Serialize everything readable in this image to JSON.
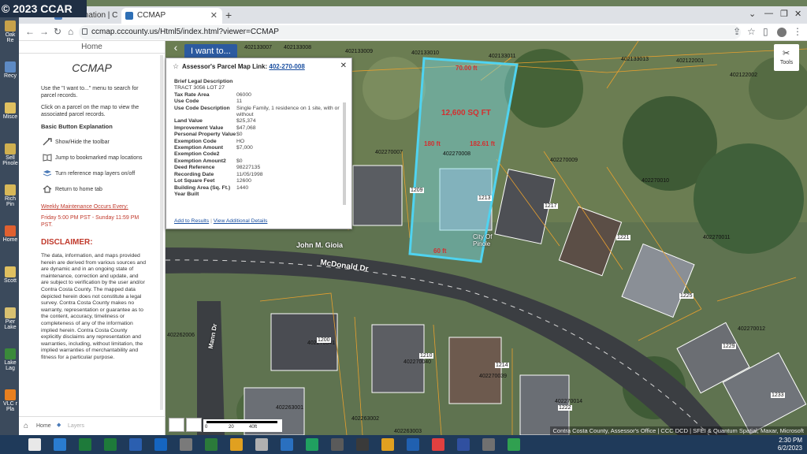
{
  "desktop": {
    "copyright": "© 2023 CCAR",
    "icons": [
      "Oak Re",
      "Recy",
      "Misce",
      "Sell Pinole",
      "Rich Pin",
      "Home",
      "Scott",
      "Pier Lake",
      "Lake Lag",
      "VLC r Pla"
    ]
  },
  "browser": {
    "tabs": [
      {
        "label": "Information | C"
      },
      {
        "label": "CCMAP"
      }
    ],
    "url": "ccmap.cccounty.us/Html5/index.html?viewer=CCMAP"
  },
  "sidebar": {
    "home": "Home",
    "title": "CCMAP",
    "intro1": "Use the \"I want to...\" menu to search for parcel records.",
    "intro2": "Click on a parcel on the map to view the associated parcel records.",
    "basic_heading": "Basic Button Explanation",
    "buttons": [
      {
        "label": "Show/Hide the toolbar",
        "icon": "tools-icon"
      },
      {
        "label": "Jump to bookmarked map locations",
        "icon": "bookmark-icon"
      },
      {
        "label": "Turn reference map layers on/off",
        "icon": "layers-icon"
      },
      {
        "label": "Return to home tab",
        "icon": "home-icon"
      }
    ],
    "maintenance": "Weekly Maintenance Occurs Every:",
    "maintenance_time": "Friday 5:00 PM PST - Sunday 11:59 PM PST.",
    "disclaimer_heading": "DISCLAIMER:",
    "disclaimer": "The data, information, and maps provided herein are derived from various sources and are dynamic and in an ongoing state of maintenance, correction and update, and are subject to verification by the user and/or Contra Costa County. The mapped data depicted herein does not constitute a legal survey. Contra Costa County makes no warranty, representation or guarantee as to the content, accuracy, timeliness or completeness of any of the information implied herein. Contra Costa County explicitly disclaims any representation and warranties, including, without limitation, the implied warranties of merchantability and fitness for a particular purpose.",
    "bottom_home": "Home",
    "bottom_layers": "Layers"
  },
  "map": {
    "i_want_to": "I want to...",
    "tools": "Tools",
    "attribution": "Contra Costa County, Assessor's Office | CCC DCD | SFEI & Quantum Spatial, Maxar, Microsoft",
    "scale": {
      "zero": "0",
      "mid": "20",
      "end": "40ft"
    },
    "parcel_labels": [
      "402133007",
      "402133008",
      "402133009",
      "402133010",
      "402133011",
      "402133013",
      "402122001",
      "402122002",
      "402270007",
      "402270008",
      "402270009",
      "402270010",
      "402270011",
      "402270012",
      "402262006",
      "402263001",
      "402263002",
      "402263003",
      "402270014",
      "402270041",
      "402270040",
      "402270039"
    ],
    "house_numbers": [
      "1209",
      "1213",
      "1217",
      "1221",
      "1225",
      "1229",
      "1233",
      "1200",
      "1210",
      "1214",
      "1222"
    ],
    "selected": {
      "area": "12,600 SQ FT",
      "top": "70.00 ft",
      "left": "180 ft",
      "right": "182.61 ft",
      "bottom": "60 ft"
    },
    "streets": {
      "main": "McDonald Dr",
      "side": "Mann Dr"
    },
    "owner_label": "John M. Gioia",
    "city_label": "City Of Pinole"
  },
  "popup": {
    "title_prefix": "Assessor's Parcel Map Link:",
    "title_link": "402-270-008",
    "rows": [
      {
        "k": "Brief Legal Description",
        "v": ""
      },
      {
        "k": "TRACT 3056 LOT 27",
        "v": ""
      },
      {
        "k": "Tax Rate Area",
        "v": "06000"
      },
      {
        "k": "Use Code",
        "v": "11"
      },
      {
        "k": "Use Code Description",
        "v": "Single Family, 1 residence on 1 site, with or without"
      },
      {
        "k": "Land Value",
        "v": "$25,374"
      },
      {
        "k": "Improvement Value",
        "v": "$47,068"
      },
      {
        "k": "Personal Property Value",
        "v": "$0"
      },
      {
        "k": "Exemption Code",
        "v": "HO"
      },
      {
        "k": "Exemption Amount",
        "v": "$7,000"
      },
      {
        "k": "Exemption Code2",
        "v": ""
      },
      {
        "k": "Exemption Amount2",
        "v": "$0"
      },
      {
        "k": "Deed Reference",
        "v": "98227135"
      },
      {
        "k": "Recording Date",
        "v": "11/05/1998"
      },
      {
        "k": "Lot Square Feet",
        "v": "12600"
      },
      {
        "k": "Building Area (Sq. Ft.)",
        "v": "1440"
      },
      {
        "k": "Year Built",
        "v": ""
      }
    ],
    "add_to_results": "Add to Results",
    "view_details": "View Additional Details"
  },
  "taskbar": {
    "time": "2:30 PM",
    "date": "6/2/2023"
  }
}
